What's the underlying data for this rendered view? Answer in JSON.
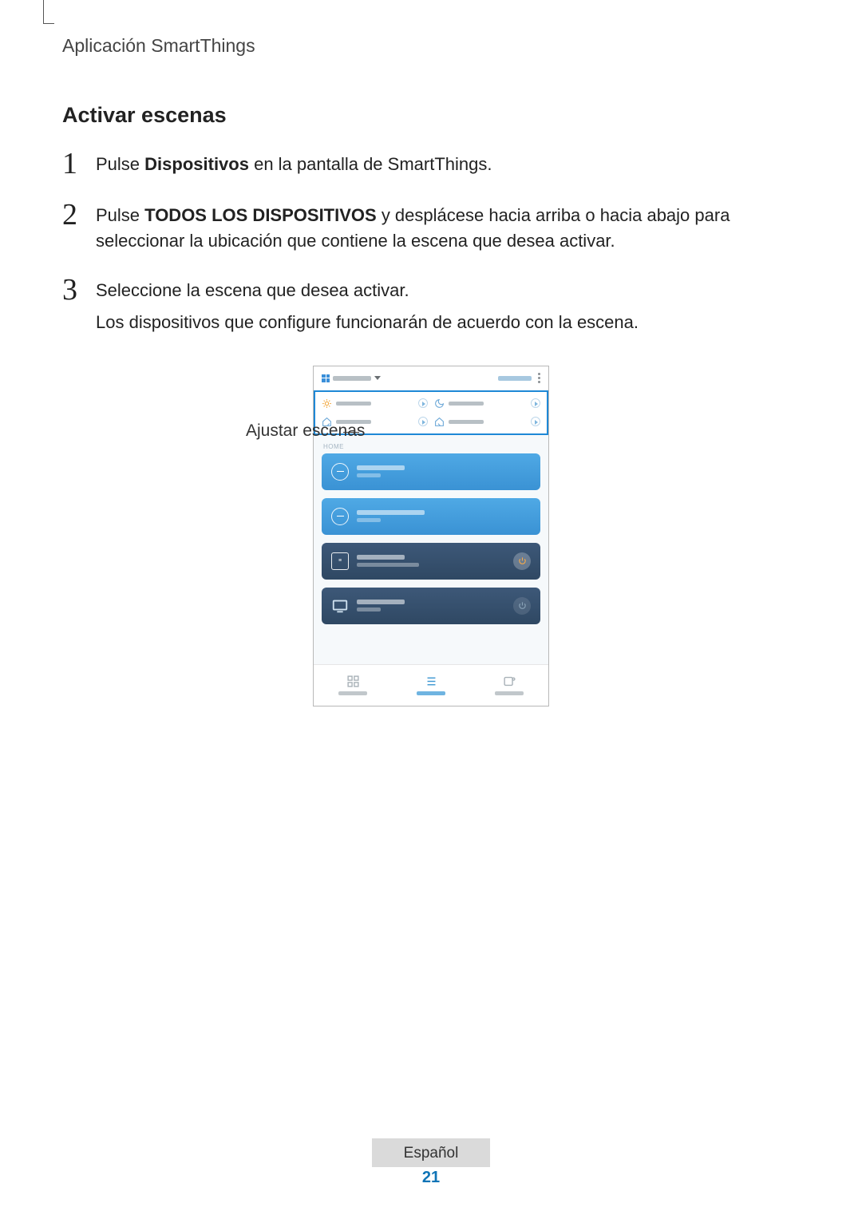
{
  "header": {
    "title": "Aplicación SmartThings"
  },
  "section": {
    "title": "Activar escenas"
  },
  "steps": [
    {
      "num": "1",
      "pre": "Pulse ",
      "bold": "Dispositivos",
      "post": " en la pantalla de SmartThings."
    },
    {
      "num": "2",
      "pre": "Pulse ",
      "bold": "TODOS LOS DISPOSITIVOS",
      "post": " y desplácese hacia arriba o hacia abajo para seleccionar la ubicación que contiene la escena que desea activar."
    },
    {
      "num": "3",
      "pre": "Seleccione la escena que desea activar.",
      "bold": "",
      "post": "",
      "sub": "Los dispositivos que configure funcionarán de acuerdo con la escena."
    }
  ],
  "callout": {
    "label": "Ajustar escenas"
  },
  "phone": {
    "section_label": "HOME",
    "tabs": [
      "Dashboard",
      "Devices",
      "Automations"
    ]
  },
  "footer": {
    "language": "Español",
    "page": "21"
  }
}
